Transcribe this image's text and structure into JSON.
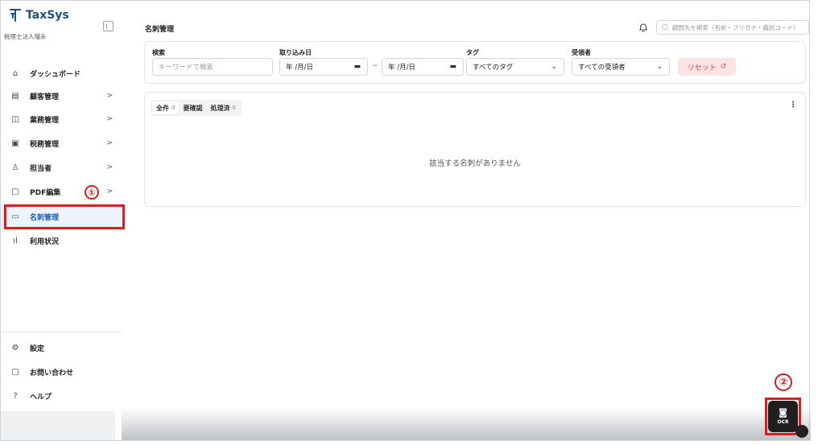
{
  "app": {
    "logo_text": "TaxSys",
    "org_name": "税理士法人増永"
  },
  "sidebar": {
    "items": [
      {
        "label": "ダッシュボード",
        "icon": "home-icon",
        "chevron": ""
      },
      {
        "label": "顧客管理",
        "icon": "building-icon",
        "chevron": ">"
      },
      {
        "label": "業務管理",
        "icon": "briefcase-icon",
        "chevron": ">"
      },
      {
        "label": "税務管理",
        "icon": "document-icon",
        "chevron": ">"
      },
      {
        "label": "担当者",
        "icon": "user-icon",
        "chevron": ">"
      },
      {
        "label": "PDF編集",
        "icon": "pdf-icon",
        "chevron": ">"
      },
      {
        "label": "名刺管理",
        "icon": "card-icon",
        "chevron": ""
      },
      {
        "label": "利用状況",
        "icon": "bar-chart-icon",
        "chevron": ""
      }
    ],
    "bottom_items": [
      {
        "label": "設定",
        "icon": "gear-icon"
      },
      {
        "label": "お問い合わせ",
        "icon": "chat-icon"
      },
      {
        "label": "ヘルプ",
        "icon": "help-icon"
      }
    ],
    "active_color": "#1d5fbf"
  },
  "annotations": {
    "one": "①",
    "two": "②",
    "color": "#e01b1b"
  },
  "header": {
    "title": "名刺管理",
    "search_placeholder": "顧問先を検索（名前・フリガナ・識別コード）"
  },
  "filters": {
    "search_label": "検索",
    "search_placeholder": "キーワードで検索",
    "date_label": "取り込み日",
    "date_from": "年 /月/日",
    "date_to": "年 /月/日",
    "date_sep": "~",
    "tag_label": "タグ",
    "tag_value": "すべてのタグ",
    "recipient_label": "受領者",
    "recipient_value": "すべての受領者",
    "reset_label": "リセット"
  },
  "tabs": [
    {
      "label": "全件",
      "count": "0"
    },
    {
      "label": "要確認",
      "count": ""
    },
    {
      "label": "処理済",
      "count": "0"
    }
  ],
  "list": {
    "empty_message": "該当する名刺がありません"
  },
  "ocr": {
    "label": "OCR"
  }
}
